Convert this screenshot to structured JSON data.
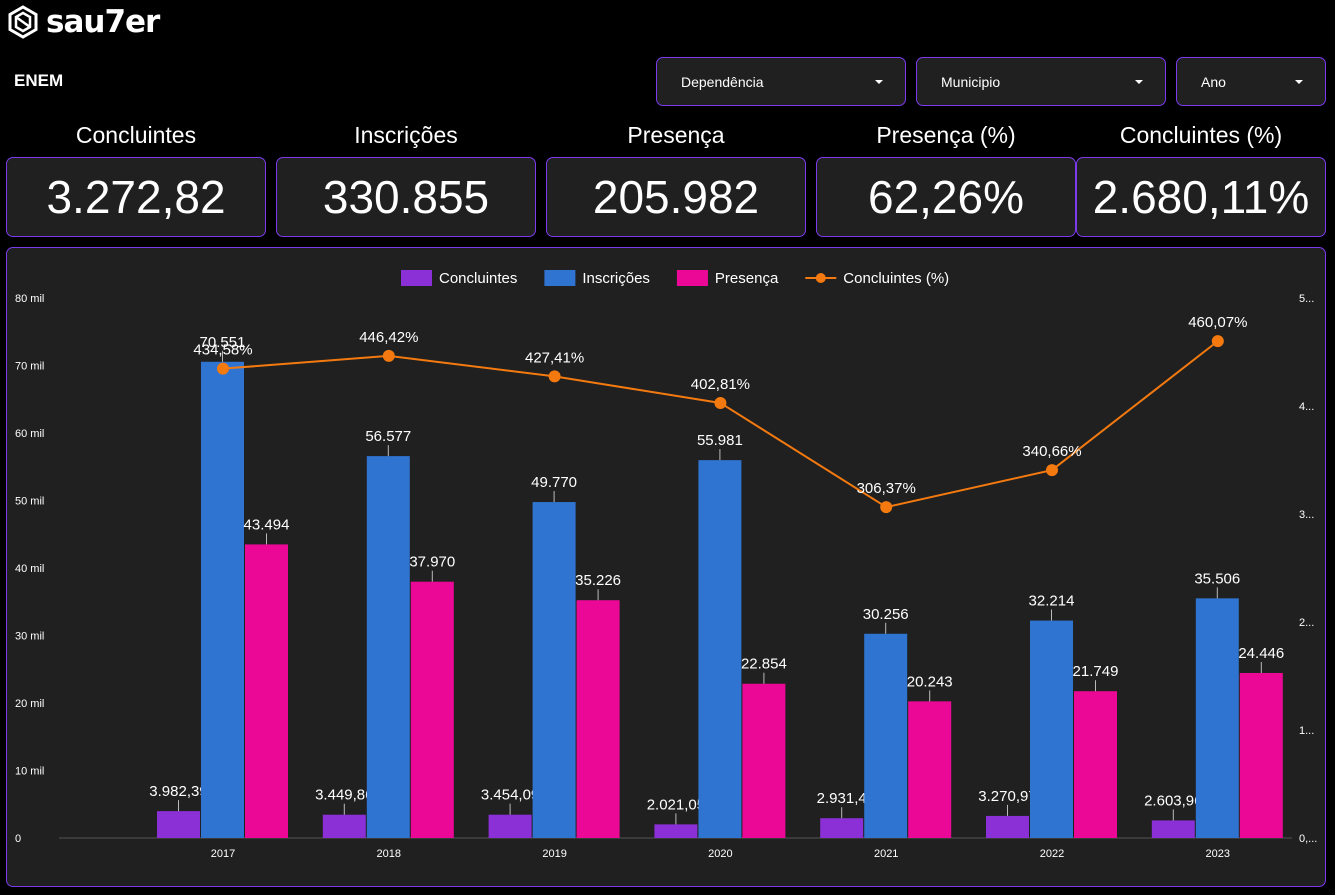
{
  "brand": {
    "logo_text": "sau7er",
    "icon": "hexagon-logo-icon"
  },
  "page": {
    "title": "ENEM"
  },
  "filters": [
    {
      "label": "Dependência"
    },
    {
      "label": "Municipio"
    },
    {
      "label": "Ano"
    }
  ],
  "kpis": [
    {
      "label": "Concluintes",
      "value": "3.272,82"
    },
    {
      "label": "Inscrições",
      "value": "330.855"
    },
    {
      "label": "Presença",
      "value": "205.982"
    },
    {
      "label": "Presença (%)",
      "value": "62,26%"
    },
    {
      "label": "Concluintes (%)",
      "value": "2.680,11%"
    }
  ],
  "colors": {
    "accent_border": "#7c3aed",
    "panel_bg": "#202020",
    "concluintes": "#8b2fd6",
    "inscricoes": "#2f74d0",
    "presenca": "#ec0896",
    "concluintes_pct": "#f47a10"
  },
  "chart_data": {
    "type": "bar",
    "categories": [
      "2017",
      "2018",
      "2019",
      "2020",
      "2021",
      "2022",
      "2023"
    ],
    "series": [
      {
        "name": "Concluintes",
        "kind": "bar",
        "axis": "left",
        "values": [
          3982.39,
          3449.86,
          3454.09,
          2021.05,
          2931.4,
          3270.97,
          2603.96
        ],
        "labels": [
          "3.982,39",
          "3.449,86",
          "3.454,09",
          "2.021,05",
          "2.931,4",
          "3.270,97",
          "2.603,96"
        ]
      },
      {
        "name": "Inscrições",
        "kind": "bar",
        "axis": "left",
        "values": [
          70551,
          56577,
          49770,
          55981,
          30256,
          32214,
          35506
        ],
        "labels": [
          "70.551",
          "56.577",
          "49.770",
          "55.981",
          "30.256",
          "32.214",
          "35.506"
        ]
      },
      {
        "name": "Presença",
        "kind": "bar",
        "axis": "left",
        "values": [
          43494,
          37970,
          35226,
          22854,
          20243,
          21749,
          24446
        ],
        "labels": [
          "43.494",
          "37.970",
          "35.226",
          "22.854",
          "20.243",
          "21.749",
          "24.446"
        ]
      },
      {
        "name": "Concluintes (%)",
        "kind": "line",
        "axis": "right",
        "values": [
          434.58,
          446.42,
          427.41,
          402.81,
          306.37,
          340.66,
          460.07
        ],
        "labels": [
          "434,58%",
          "446,42%",
          "427,41%",
          "402,81%",
          "306,37%",
          "340,66%",
          "460,07%"
        ]
      }
    ],
    "y_left": {
      "ticks": [
        "0",
        "10 mil",
        "20 mil",
        "30 mil",
        "40 mil",
        "50 mil",
        "60 mil",
        "70 mil",
        "80 mil"
      ],
      "ylim": [
        0,
        80000
      ]
    },
    "y_right": {
      "ticks": [
        "0,...",
        "1...",
        "2...",
        "3...",
        "4...",
        "5..."
      ],
      "ylim": [
        0,
        500
      ]
    },
    "legend_position": "top-center",
    "grid": false
  }
}
